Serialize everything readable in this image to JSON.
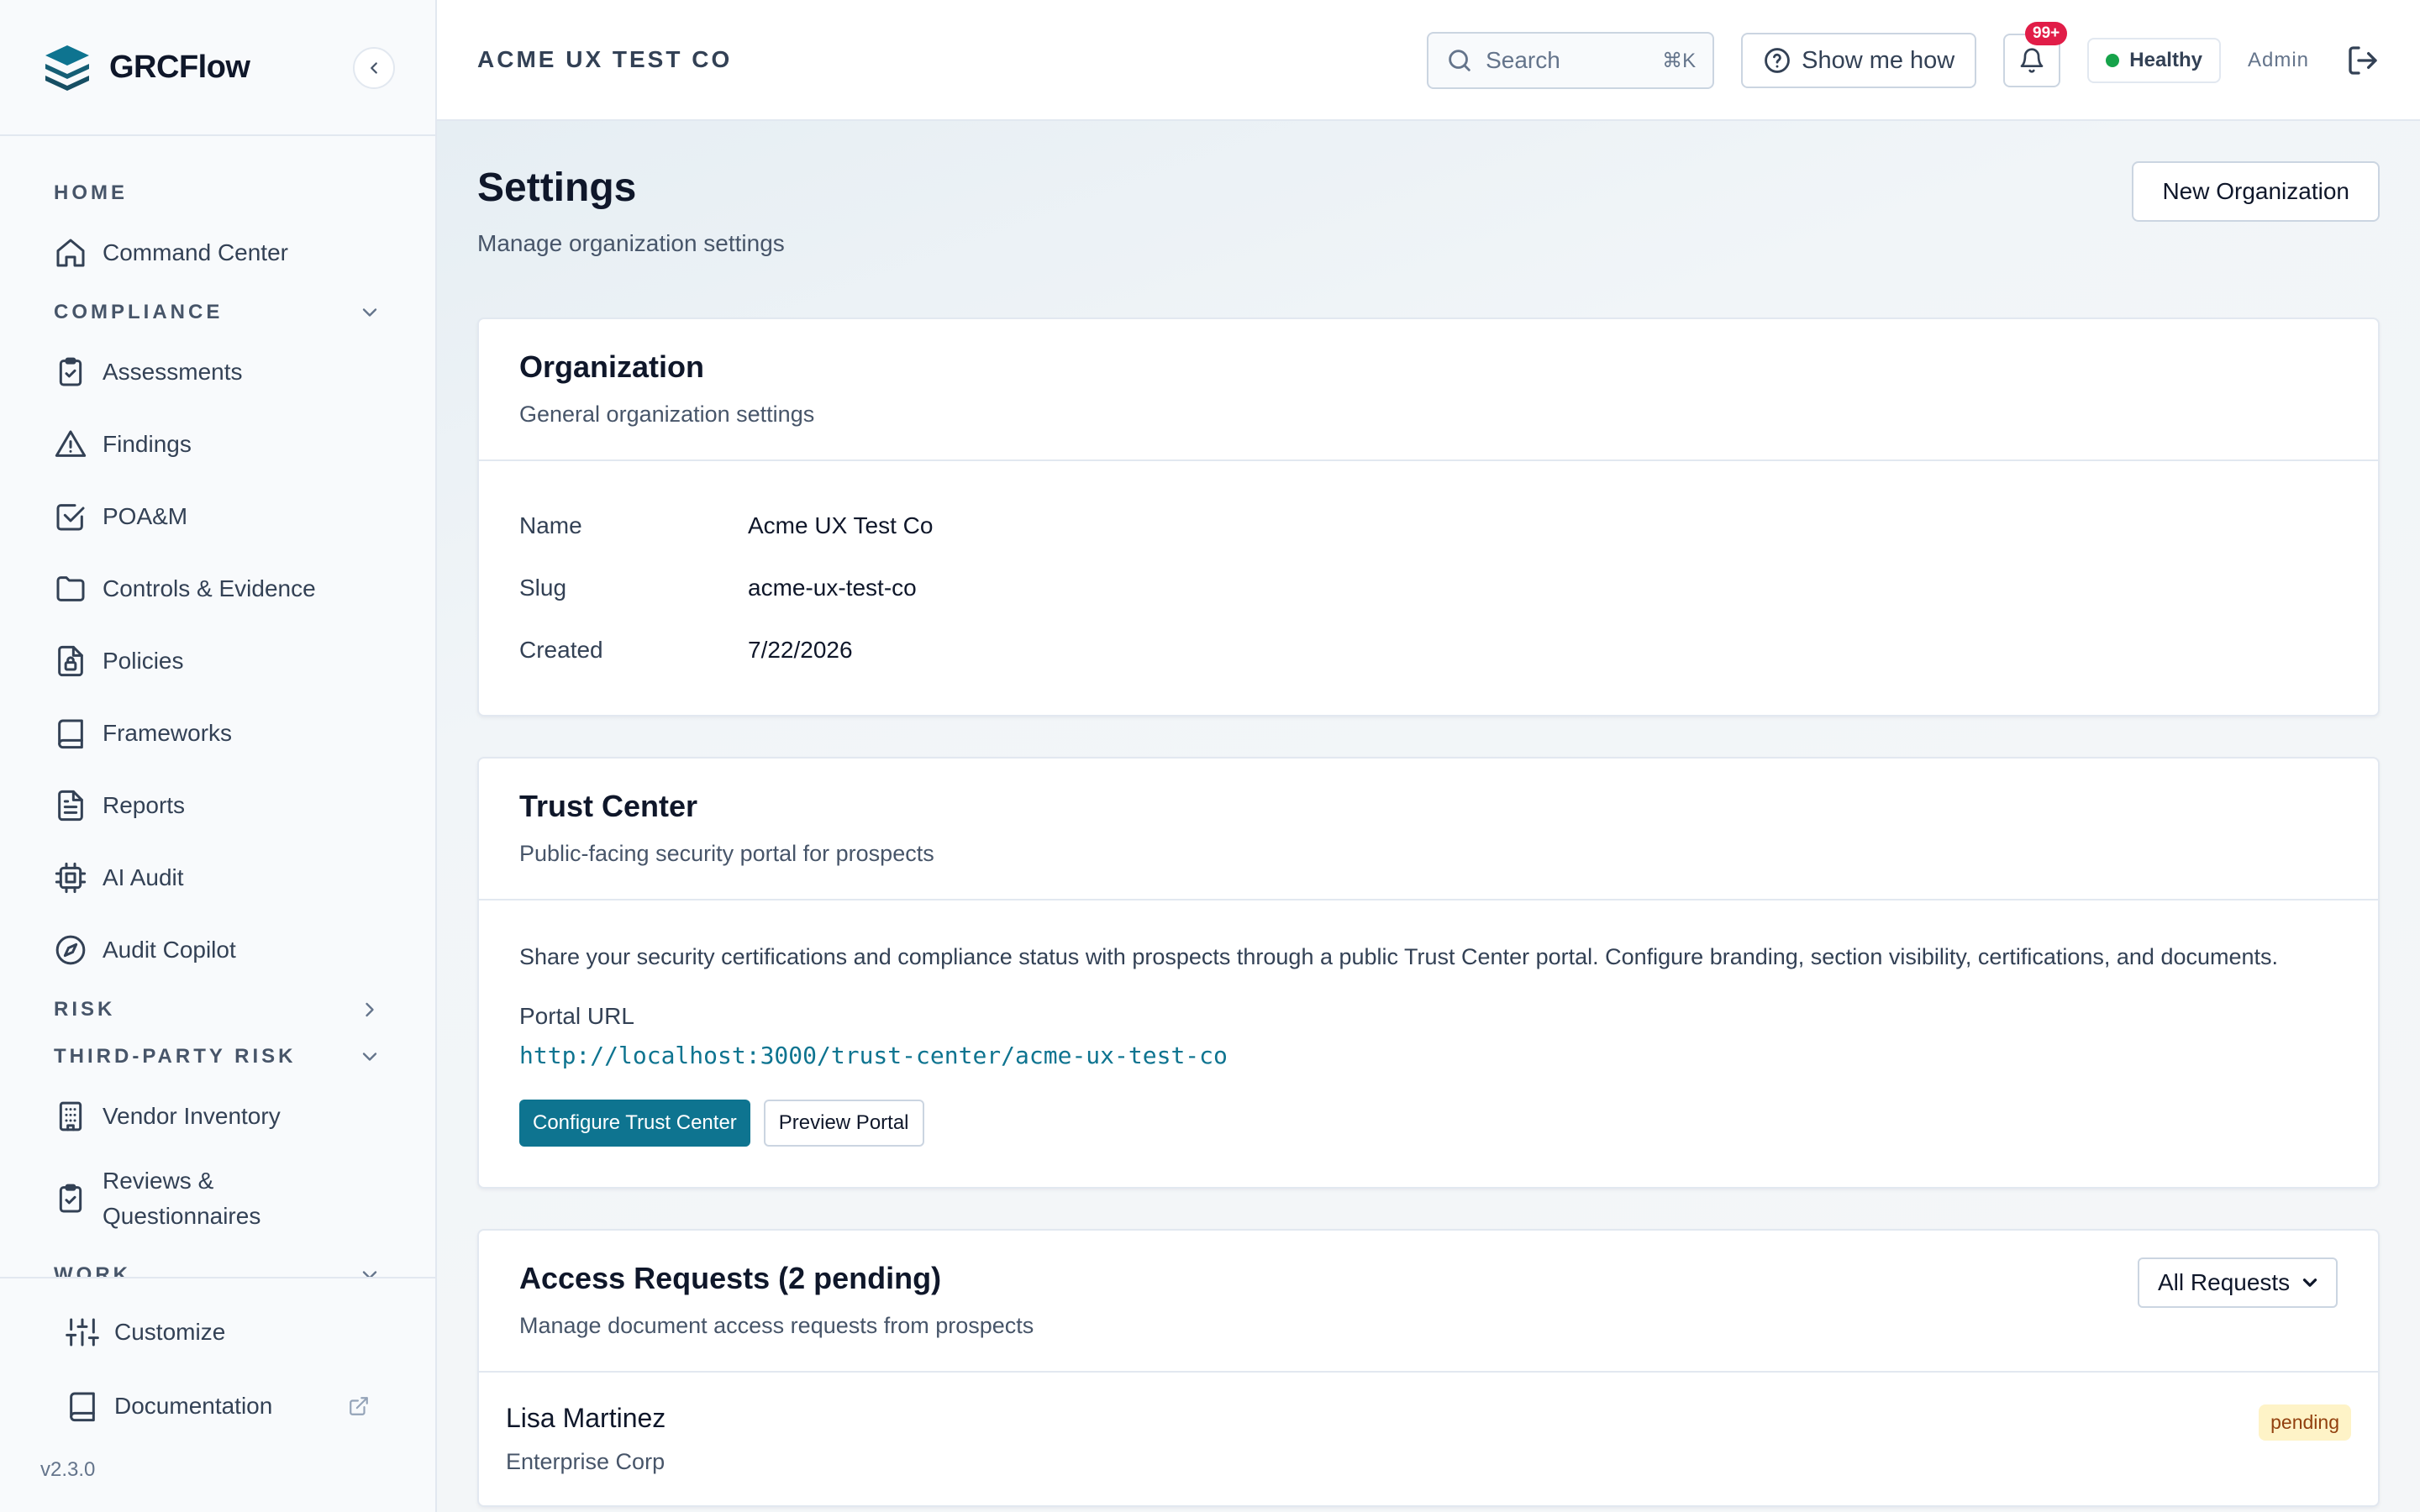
{
  "app": {
    "brand": "GRCFlow",
    "version": "v2.3.0"
  },
  "sidebar": {
    "sections": {
      "home": "HOME",
      "compliance": "COMPLIANCE",
      "risk": "RISK",
      "third_party": "THIRD-PARTY RISK",
      "work": "WORK"
    },
    "items": {
      "command_center": "Command Center",
      "assessments": "Assessments",
      "findings": "Findings",
      "poam": "POA&M",
      "controls": "Controls & Evidence",
      "policies": "Policies",
      "frameworks": "Frameworks",
      "reports": "Reports",
      "ai_audit": "AI Audit",
      "audit_copilot": "Audit Copilot",
      "vendor_inventory": "Vendor Inventory",
      "reviews": "Reviews &\nQuestionnaires"
    },
    "footer": {
      "customize": "Customize",
      "documentation": "Documentation"
    }
  },
  "header": {
    "org_name": "ACME UX TEST CO",
    "search_placeholder": "Search",
    "search_shortcut": "⌘K",
    "show_me_how": "Show me how",
    "notification_count": "99+",
    "health_status": "Healthy",
    "user_role": "Admin"
  },
  "page": {
    "title": "Settings",
    "subtitle": "Manage organization settings",
    "new_org_button": "New Organization"
  },
  "organization": {
    "title": "Organization",
    "description": "General organization settings",
    "fields": [
      {
        "label": "Name",
        "value": "Acme UX Test Co"
      },
      {
        "label": "Slug",
        "value": "acme-ux-test-co"
      },
      {
        "label": "Created",
        "value": "7/22/2026"
      }
    ]
  },
  "trust_center": {
    "title": "Trust Center",
    "description": "Public-facing security portal for prospects",
    "body": "Share your security certifications and compliance status with prospects through a public Trust Center portal. Configure branding, section visibility, certifications, and documents.",
    "portal_url_label": "Portal URL",
    "portal_url": "http://localhost:3000/trust-center/acme-ux-test-co",
    "configure_button": "Configure Trust Center",
    "preview_button": "Preview Portal"
  },
  "access_requests": {
    "title": "Access Requests (2 pending)",
    "description": "Manage document access requests from prospects",
    "filter_value": "All Requests",
    "rows": [
      {
        "name": "Lisa Martinez",
        "company": "Enterprise Corp",
        "status": "pending"
      }
    ]
  },
  "colors": {
    "accent": "#0e7490",
    "badge_red": "#e11d48",
    "health_green": "#16a34a",
    "pending_bg": "#fef3c7"
  }
}
